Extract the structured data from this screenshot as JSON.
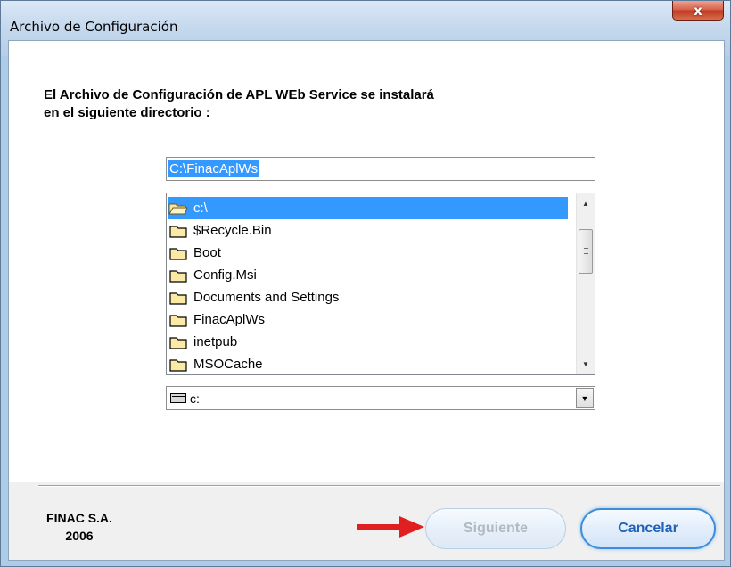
{
  "window": {
    "title": "Archivo de Configuración",
    "close_label": "x"
  },
  "message": {
    "line1": "El Archivo de Configuración de APL WEb Service se instalará",
    "line2": "en el siguiente directorio :"
  },
  "path_input": {
    "value": "C:\\FinacAplWs"
  },
  "directory_list": {
    "items": [
      {
        "label": "c:\\",
        "icon": "open-folder-icon",
        "selected": true
      },
      {
        "label": "$Recycle.Bin",
        "icon": "folder-icon",
        "selected": false
      },
      {
        "label": "Boot",
        "icon": "folder-icon",
        "selected": false
      },
      {
        "label": "Config.Msi",
        "icon": "folder-icon",
        "selected": false
      },
      {
        "label": "Documents and Settings",
        "icon": "folder-icon",
        "selected": false
      },
      {
        "label": "FinacAplWs",
        "icon": "folder-icon",
        "selected": false
      },
      {
        "label": "inetpub",
        "icon": "folder-icon",
        "selected": false
      },
      {
        "label": "MSOCache",
        "icon": "folder-icon",
        "selected": false
      }
    ]
  },
  "drive_select": {
    "value": "c:",
    "icon": "drive-icon"
  },
  "footer": {
    "company_line1": "FINAC S.A.",
    "company_line2": "2006"
  },
  "buttons": {
    "next_label": "Siguiente",
    "next_enabled": false,
    "cancel_label": "Cancelar"
  },
  "colors": {
    "selection": "#3399ff",
    "arrow": "#e02020",
    "title_gradient_top": "#dbe8f6",
    "close_button": "#c13b23"
  }
}
